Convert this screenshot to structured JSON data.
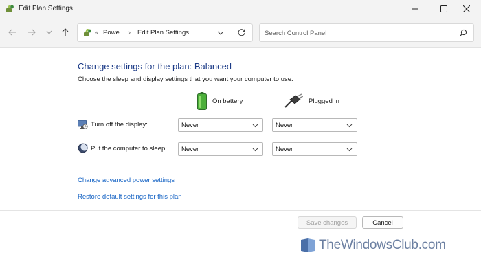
{
  "window": {
    "title": "Edit Plan Settings"
  },
  "navigation": {
    "breadcrumb": [
      "Powe...",
      "Edit Plan Settings"
    ],
    "search_placeholder": "Search Control Panel"
  },
  "main": {
    "heading": "Change settings for the plan: Balanced",
    "subheading": "Choose the sleep and display settings that you want your computer to use.",
    "columns": {
      "battery": "On battery",
      "plugged_in": "Plugged in"
    },
    "rows": [
      {
        "label": "Turn off the display:",
        "on_battery": "Never",
        "plugged_in": "Never",
        "icon": "monitor-icon"
      },
      {
        "label": "Put the computer to sleep:",
        "on_battery": "Never",
        "plugged_in": "Never",
        "icon": "moon-icon"
      }
    ],
    "links": {
      "advanced": "Change advanced power settings",
      "restore": "Restore default settings for this plan"
    }
  },
  "footer": {
    "save_label": "Save changes",
    "save_enabled": false,
    "cancel_label": "Cancel"
  },
  "watermark": {
    "text": "TheWindowsClub.com"
  },
  "colors": {
    "heading": "#1c3b87",
    "link": "#1563c4",
    "titlebar": "#f3f3f3"
  }
}
